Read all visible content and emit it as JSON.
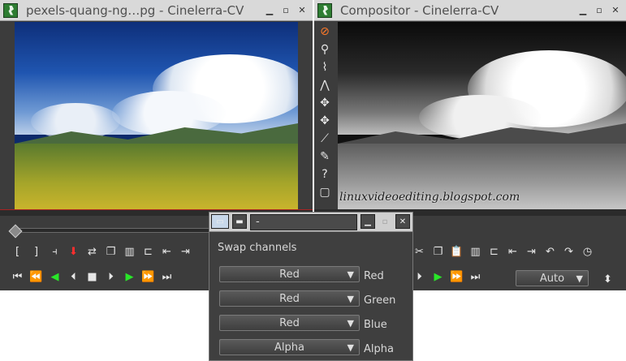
{
  "viewer_window": {
    "title": "pexels-quang-ng…pg - Cinelerra-CV"
  },
  "compositor_window": {
    "title": "Compositor - Cinelerra-CV",
    "watermark": "linuxvideoediting.blogspot.com",
    "zoom_select": "Auto"
  },
  "swap_dialog": {
    "title_field": "-",
    "heading": "Swap channels",
    "channels": [
      {
        "source": "Red",
        "target": "Red"
      },
      {
        "source": "Red",
        "target": "Green"
      },
      {
        "source": "Red",
        "target": "Blue"
      },
      {
        "source": "Alpha",
        "target": "Alpha"
      }
    ]
  },
  "colors": {
    "panel_bg": "#3c3c3c",
    "titlebar_bg": "#d9d9d9",
    "play_green": "#29e629",
    "mark_red": "#ff2e2e",
    "tool_orange": "#ff7a2a"
  },
  "icons": {
    "app": "cinelerra-icon",
    "play": "play-icon",
    "rewind": "rewind-icon",
    "fast_forward": "fast-forward-icon"
  }
}
